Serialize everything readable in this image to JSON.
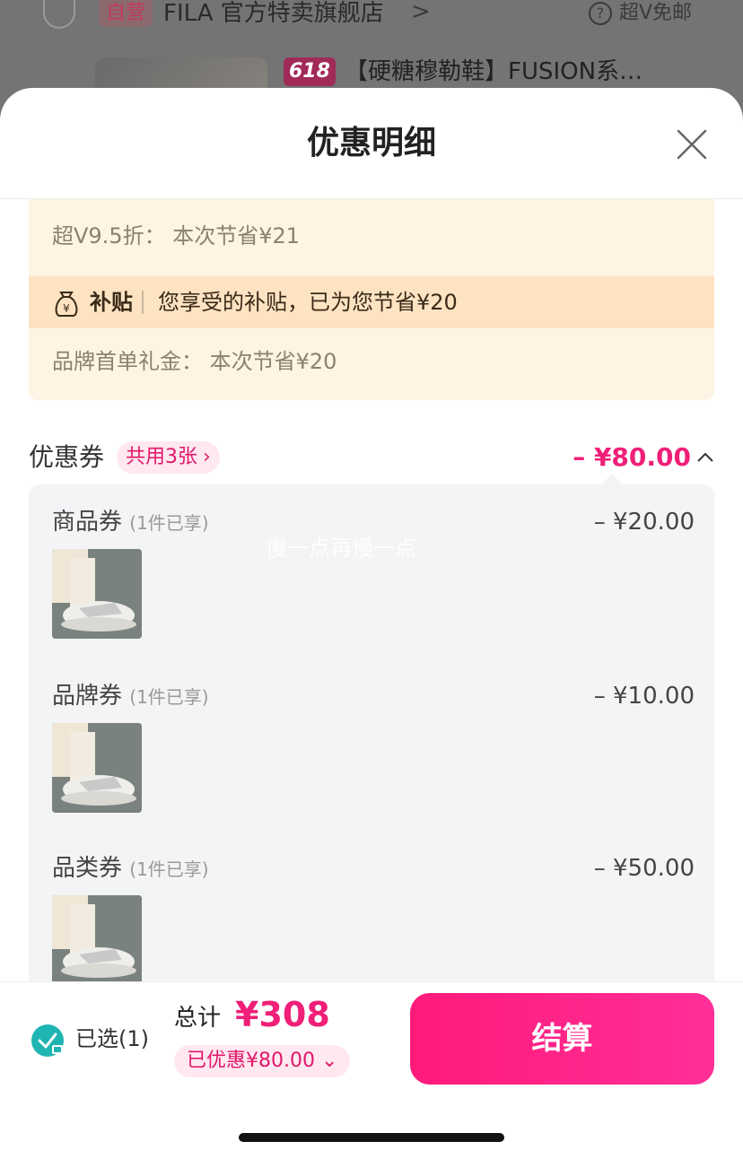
{
  "background_page": {
    "self_run_tag": "自营",
    "store_name": "FILA 官方特卖旗舰店",
    "store_arrow": ">",
    "help_icon": "?",
    "shipping_text": "超V免邮",
    "promo_tag": "618",
    "product_title": "【硬糖穆勒鞋】FUSION系…"
  },
  "sheet": {
    "title": "优惠明细",
    "close_icon": "close-icon"
  },
  "discounts": {
    "super_v": "超V9.5折：  本次节省¥21",
    "subsidy_label": "补贴",
    "subsidy_text": "您享受的补贴，已为您节省¥20",
    "brand_first": "品牌首单礼金：  本次节省¥20"
  },
  "coupons": {
    "title": "优惠券",
    "badge": "共用3张",
    "total": "– ¥80.00",
    "items": [
      {
        "name": "商品券",
        "sub": "(1件已享)",
        "amount": "– ¥20.00"
      },
      {
        "name": "品牌券",
        "sub": "(1件已享)",
        "amount": "– ¥10.00"
      },
      {
        "name": "品类券",
        "sub": "(1件已享)",
        "amount": "– ¥50.00"
      }
    ]
  },
  "watermark": "慢一点再慢一点",
  "bottom": {
    "selected": "已选(1)",
    "total_label": "总计",
    "total_price": "¥308",
    "saved": "已优惠¥80.00",
    "checkout": "结算"
  },
  "colors": {
    "accent": "#f01f78",
    "checkout_start": "#ff1a7a",
    "checkout_end": "#ff2f98",
    "check_teal": "#1fb5b3"
  }
}
